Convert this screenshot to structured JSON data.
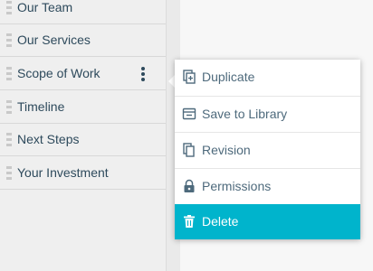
{
  "sidebar": {
    "items": [
      {
        "label": "Our Team"
      },
      {
        "label": "Our Services"
      },
      {
        "label": "Scope of Work"
      },
      {
        "label": "Timeline"
      },
      {
        "label": "Next Steps"
      },
      {
        "label": "Your Investment"
      }
    ]
  },
  "context_menu": {
    "items": [
      {
        "label": "Duplicate",
        "icon": "duplicate-icon"
      },
      {
        "label": "Save to Library",
        "icon": "library-icon"
      },
      {
        "label": "Revision",
        "icon": "revision-icon"
      },
      {
        "label": "Permissions",
        "icon": "lock-icon"
      },
      {
        "label": "Delete",
        "icon": "trash-icon"
      }
    ],
    "highlighted": "Delete"
  },
  "colors": {
    "accent": "#00b4cc",
    "text": "#2e4a5c",
    "menu_text": "#4e6a7c"
  }
}
